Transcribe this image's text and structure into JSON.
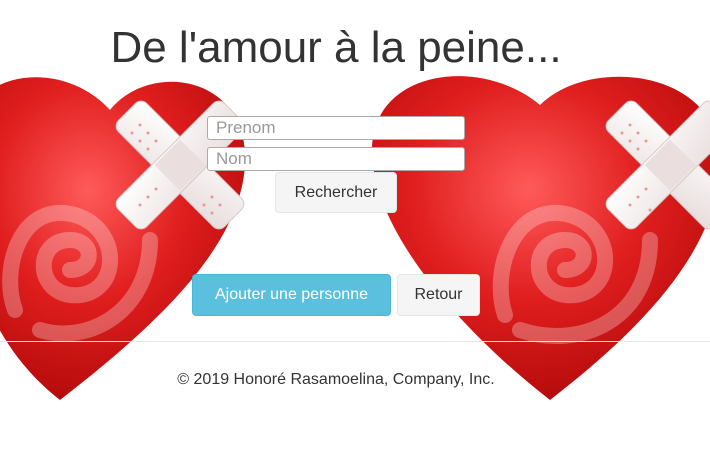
{
  "header": {
    "title": "De l'amour à la peine..."
  },
  "search_form": {
    "firstname_placeholder": "Prenom",
    "firstname_value": "",
    "lastname_placeholder": "Nom",
    "lastname_value": "",
    "search_label": "Rechercher"
  },
  "actions": {
    "add_label": "Ajouter une personne",
    "back_label": "Retour"
  },
  "footer": {
    "copyright": "© 2019 Honoré Rasamoelina, Company, Inc."
  },
  "background": {
    "image_icon": "bandaged-heart-icon",
    "colors": {
      "heart_red": "#d01818",
      "bandage": "#f2e8e8",
      "accent_info": "#5bc0de"
    }
  }
}
